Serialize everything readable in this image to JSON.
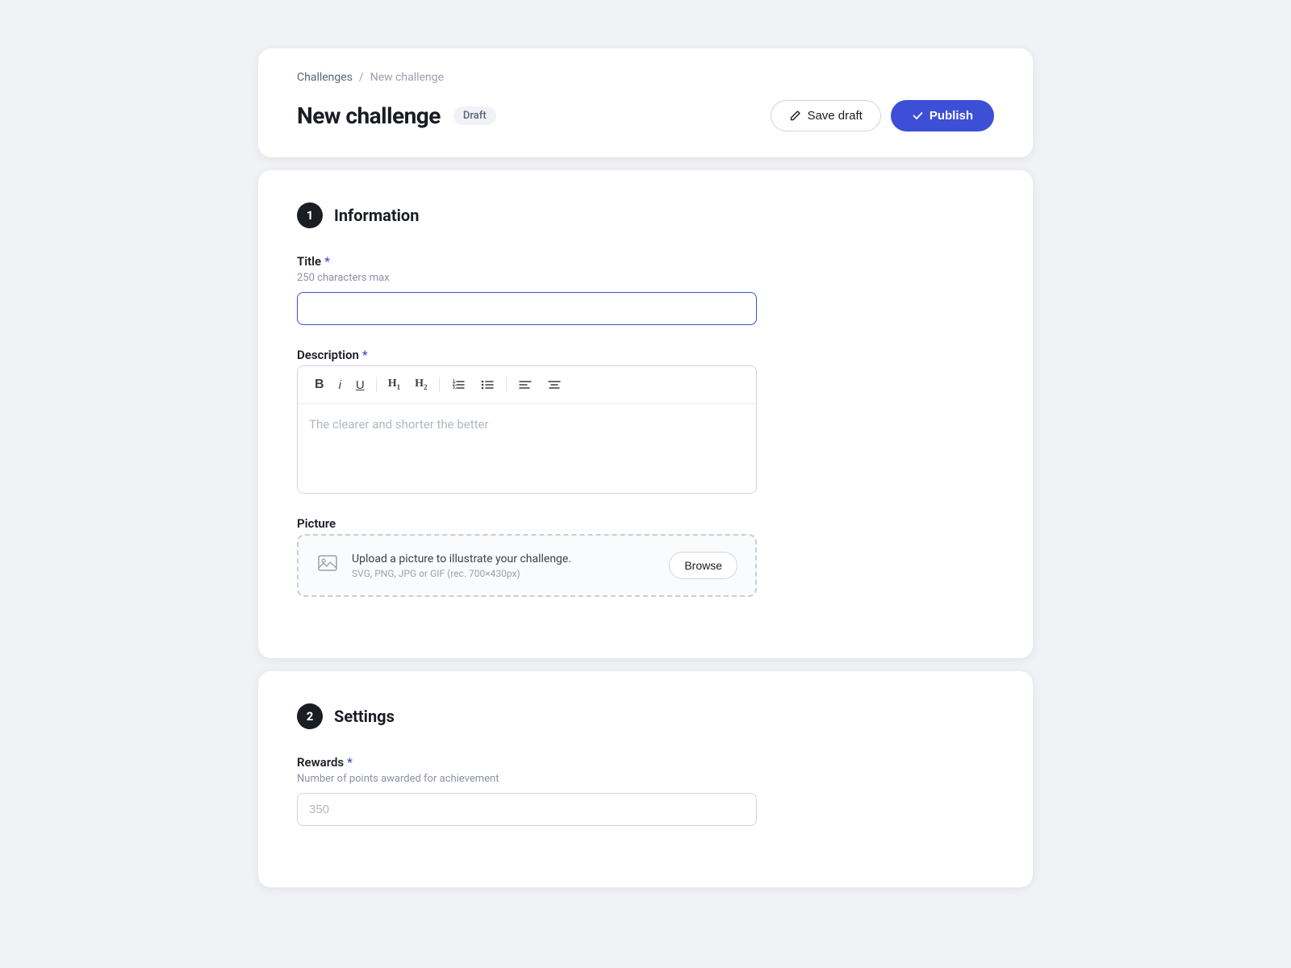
{
  "breadcrumb": {
    "parent": "Challenges",
    "separator": "/",
    "current": "New challenge"
  },
  "header": {
    "title": "New challenge",
    "status": "Draft",
    "save_draft_label": "Save draft",
    "publish_label": "Publish"
  },
  "section1": {
    "number": "1",
    "title": "Information",
    "title_field": {
      "label": "Title",
      "required": "*",
      "hint": "250 characters max",
      "placeholder": ""
    },
    "description_field": {
      "label": "Description",
      "required": "*",
      "placeholder": "The clearer and shorter the better"
    },
    "picture_field": {
      "label": "Picture",
      "upload_text": "Upload a picture to illustrate your challenge.",
      "upload_hint": "SVG, PNG, JPG or GIF (rec. 700×430px)",
      "browse_label": "Browse"
    },
    "toolbar": {
      "bold": "B",
      "italic": "i",
      "underline": "U",
      "h1": "H",
      "h1_sub": "1",
      "h2": "H",
      "h2_sub": "2"
    }
  },
  "section2": {
    "number": "2",
    "title": "Settings",
    "rewards_field": {
      "label": "Rewards",
      "required": "*",
      "hint": "Number of points awarded for achievement",
      "placeholder": "350"
    }
  }
}
